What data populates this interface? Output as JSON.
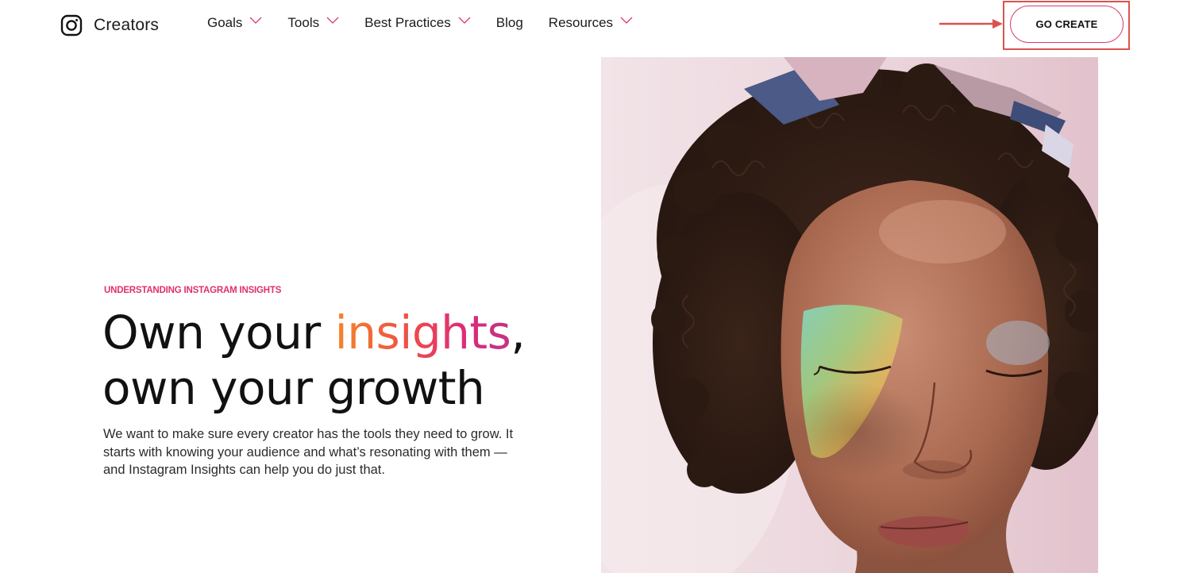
{
  "header": {
    "brand_name": "Creators",
    "nav": [
      {
        "label": "Goals",
        "has_dropdown": true
      },
      {
        "label": "Tools",
        "has_dropdown": true
      },
      {
        "label": "Best Practices",
        "has_dropdown": true
      },
      {
        "label": "Blog",
        "has_dropdown": false
      },
      {
        "label": "Resources",
        "has_dropdown": true
      }
    ],
    "cta_label": "GO CREATE"
  },
  "hero": {
    "eyebrow": "UNDERSTANDING INSTAGRAM INSIGHTS",
    "headline_part1": "Own your ",
    "headline_accent": "insights",
    "headline_part2": ",",
    "headline_line2": "own your growth",
    "body": "We want to make sure every creator has the tools they need to grow. It starts with knowing your audience and what’s resonating with them — and Instagram Insights can help you do just that."
  },
  "colors": {
    "accent_pink": "#e1306c",
    "chevron_pink": "#d63b6f",
    "annotation_red": "#d9534f",
    "gradient": [
      "#f58529",
      "#ee4a4a",
      "#dd2a7b",
      "#c13584"
    ]
  },
  "icons": {
    "brand": "instagram-icon",
    "dropdown": "chevron-down-icon",
    "annotation": "arrow-right-icon"
  }
}
